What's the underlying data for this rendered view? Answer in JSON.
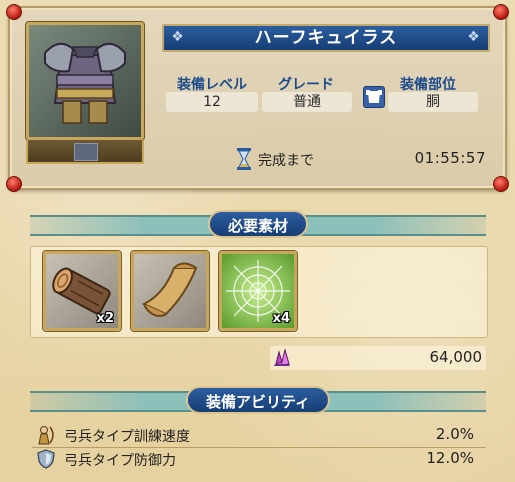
{
  "item": {
    "name": "ハーフキュイラス",
    "icon": "armor-icon"
  },
  "stats": {
    "level_label": "装備レベル",
    "level_value": "12",
    "grade_label": "グレード",
    "grade_value": "普通",
    "slot_label": "装備部位",
    "slot_value": "胴"
  },
  "timer": {
    "label": "完成まで",
    "value": "01:55:57"
  },
  "materials": {
    "header": "必要素材",
    "items": [
      {
        "icon": "log-icon",
        "count": "x2"
      },
      {
        "icon": "scroll-icon",
        "count": ""
      },
      {
        "icon": "spiderweb-icon",
        "count": "x4"
      }
    ],
    "cost": "64,000",
    "cost_icon": "crystal-icon"
  },
  "abilities": {
    "header": "装備アビリティ",
    "rows": [
      {
        "name": "弓兵タイプ訓練速度",
        "value": "2.0%",
        "icon": "archer-icon"
      },
      {
        "name": "弓兵タイプ防御力",
        "value": "12.0%",
        "icon": "shield-icon"
      }
    ]
  },
  "colors": {
    "accent_blue": "#1d4c8d",
    "gold_frame": "#c9a85b",
    "teal_band": "#8cc0bb"
  }
}
